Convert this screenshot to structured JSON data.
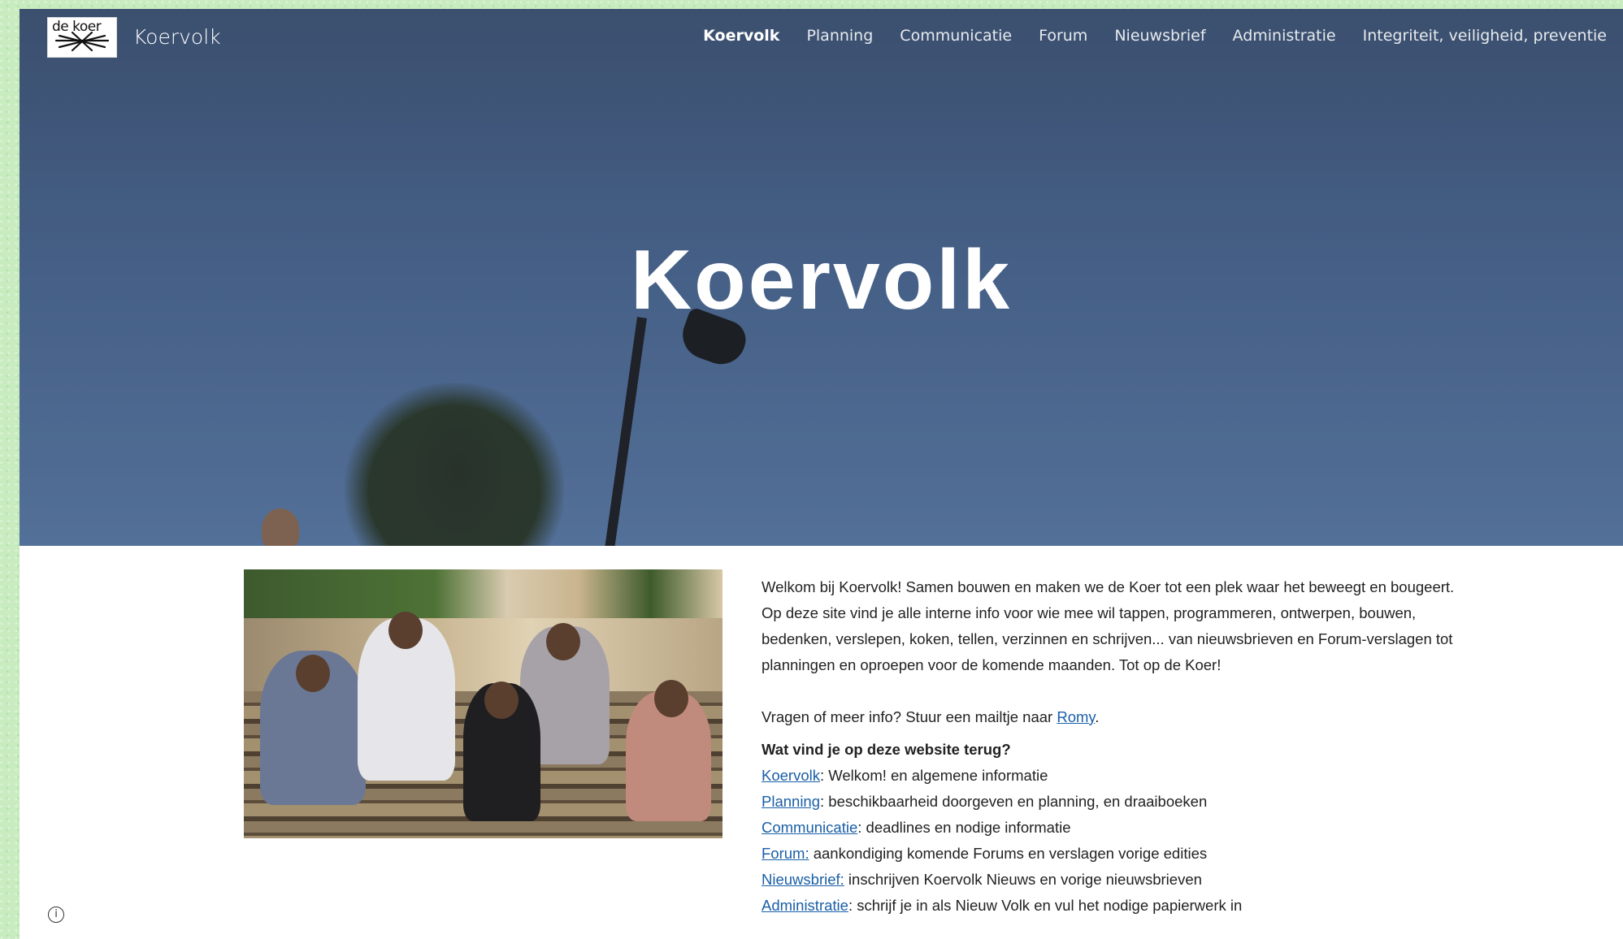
{
  "header": {
    "logo_text": "de koer",
    "site_title": "Koervolk",
    "nav": [
      {
        "label": "Koervolk",
        "active": true
      },
      {
        "label": "Planning",
        "active": false
      },
      {
        "label": "Communicatie",
        "active": false
      },
      {
        "label": "Forum",
        "active": false
      },
      {
        "label": "Nieuwsbrief",
        "active": false
      },
      {
        "label": "Administratie",
        "active": false
      },
      {
        "label": "Integriteit, veiligheid, preventie",
        "active": false
      }
    ]
  },
  "hero": {
    "title": "Koervolk"
  },
  "content": {
    "intro": "Welkom bij Koervolk! Samen bouwen en maken we de Koer tot een plek waar het beweegt en bougeert. Op deze site vind je alle interne info voor wie mee wil tappen, programmeren, ontwerpen, bouwen, bedenken, verslepen, koken, tellen, verzinnen en schrijven... van nieuwsbrieven en Forum-verslagen tot planningen en oproepen voor de komende maanden. Tot op de Koer!",
    "contact_prefix": "Vragen of meer info? Stuur een mailtje naar ",
    "contact_link": "Romy",
    "contact_suffix": ".",
    "section_heading": "Wat vind je op deze website terug?",
    "items": [
      {
        "link": "Koervolk",
        "text": ":  Welkom! en algemene informatie"
      },
      {
        "link": "Planning",
        "text": ": beschikbaarheid doorgeven en planning, en draaiboeken"
      },
      {
        "link": "Communicatie",
        "text": ": deadlines en nodige informatie"
      },
      {
        "link": "Forum:",
        "text": " aankondiging komende Forums en verslagen vorige edities"
      },
      {
        "link": "Nieuwsbrief:",
        "text": " inschrijven Koervolk Nieuws en vorige nieuwsbrieven"
      },
      {
        "link": "Administratie",
        "text": ": schrijf je in als Nieuw Volk en vul het nodige papierwerk in"
      }
    ]
  },
  "colors": {
    "link": "#1a5fa8",
    "hero_sky": "#4a6690",
    "background_border": "#c8ecc0"
  },
  "icons": {
    "info": "info-icon"
  }
}
